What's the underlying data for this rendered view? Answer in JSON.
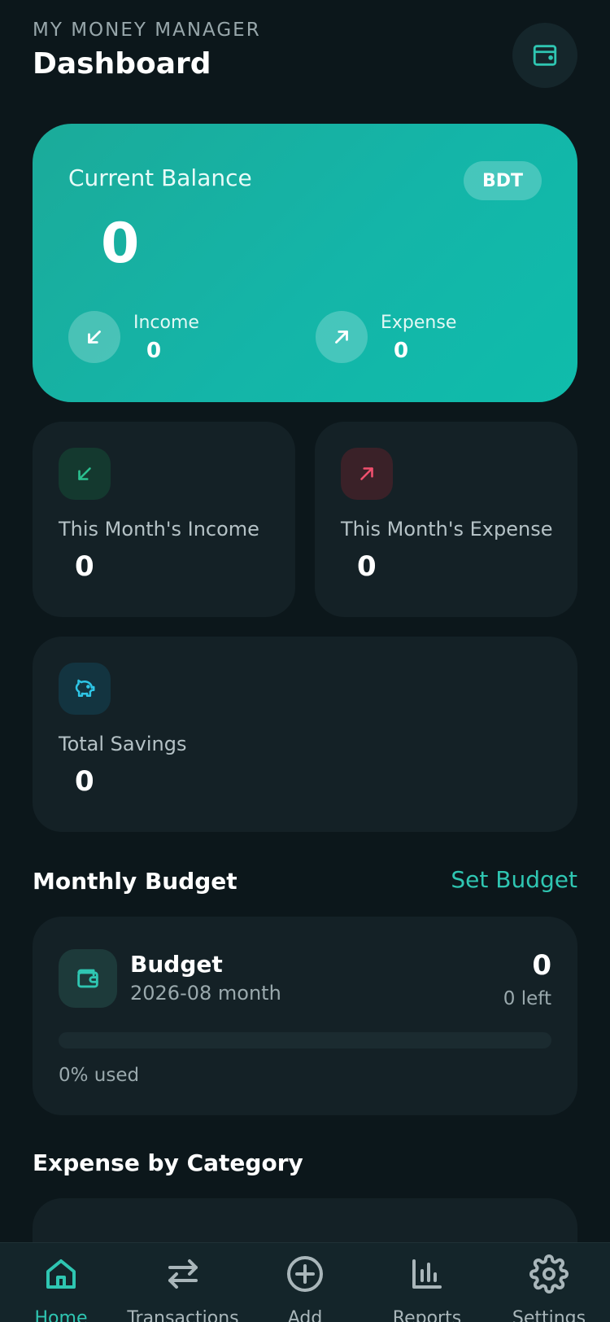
{
  "app": {
    "name": "MY MONEY MANAGER",
    "page_title": "Dashboard"
  },
  "balance_card": {
    "label": "Current Balance",
    "currency": "BDT",
    "value": "0",
    "income_label": "Income",
    "income_value": "0",
    "expense_label": "Expense",
    "expense_value": "0"
  },
  "stats": {
    "month_income_label": "This Month's Income",
    "month_income_value": "0",
    "month_expense_label": "This Month's Expense",
    "month_expense_value": "0",
    "savings_label": "Total Savings",
    "savings_value": "0"
  },
  "budget": {
    "section_title": "Monthly Budget",
    "set_budget_label": "Set Budget",
    "title": "Budget",
    "period": "2026-08 month",
    "amount": "0",
    "left": "0 left",
    "used_text": "0% used",
    "used_fraction": 0
  },
  "expense_category": {
    "section_title": "Expense by Category"
  },
  "nav": {
    "items": [
      {
        "label": "Home",
        "icon": "home-icon",
        "active": true
      },
      {
        "label": "Transactions",
        "icon": "transfer-arrows-icon",
        "active": false
      },
      {
        "label": "Add",
        "icon": "plus-circle-icon",
        "active": false
      },
      {
        "label": "Reports",
        "icon": "bar-chart-icon",
        "active": false
      },
      {
        "label": "Settings",
        "icon": "gear-icon",
        "active": false
      }
    ]
  },
  "colors": {
    "background": "#0c171b",
    "card": "#142126",
    "accent": "#2fc6b2",
    "income": "#2bbf8f",
    "expense": "#f0506e"
  }
}
